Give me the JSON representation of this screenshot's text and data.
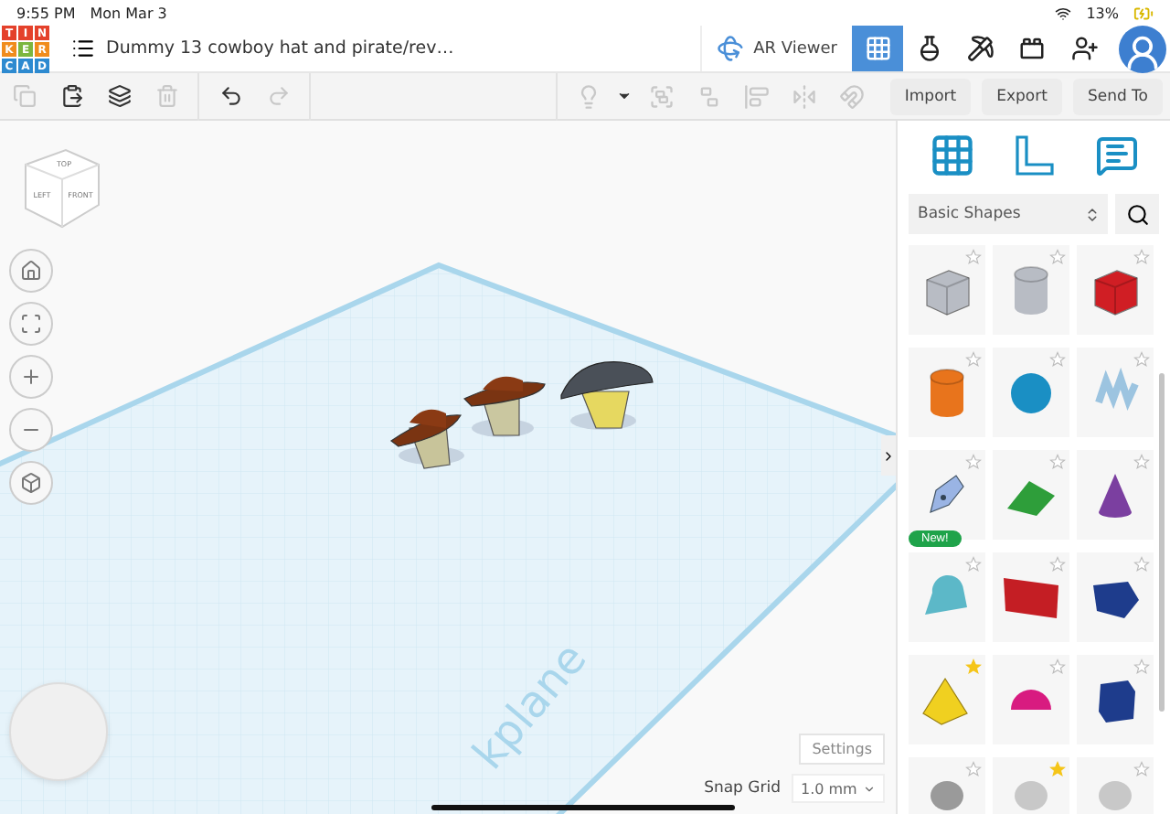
{
  "status_bar": {
    "time": "9:55 PM",
    "date": "Mon Mar 3",
    "battery": "13%"
  },
  "header": {
    "logo_letters": [
      "T",
      "I",
      "N",
      "K",
      "E",
      "R",
      "C",
      "A",
      "D"
    ],
    "title": "Dummy 13 cowboy hat and pirate/rev…",
    "ar_viewer": "AR Viewer",
    "views": [
      {
        "kind": "design",
        "selected": true
      },
      {
        "kind": "sim",
        "selected": false
      },
      {
        "kind": "pickaxe",
        "selected": false
      },
      {
        "kind": "brick",
        "selected": false
      }
    ]
  },
  "toolbar": {
    "left": [
      {
        "kind": "copy",
        "disabled": true
      },
      {
        "kind": "paste",
        "disabled": false
      },
      {
        "kind": "duplicate",
        "disabled": false
      },
      {
        "kind": "delete",
        "disabled": true
      },
      {
        "kind": "undo",
        "disabled": false
      },
      {
        "kind": "redo",
        "disabled": true
      }
    ],
    "right": [
      {
        "kind": "light",
        "disabled": true
      },
      {
        "kind": "caret",
        "disabled": false
      },
      {
        "kind": "group",
        "disabled": true
      },
      {
        "kind": "ungroup",
        "disabled": true
      },
      {
        "kind": "align",
        "disabled": true
      },
      {
        "kind": "mirror",
        "disabled": true
      },
      {
        "kind": "magnet",
        "disabled": true
      }
    ],
    "buttons": [
      "Import",
      "Export",
      "Send To"
    ]
  },
  "canvas": {
    "view_cube": {
      "top": "TOP",
      "left": "LEFT",
      "front": "FRONT"
    },
    "nav": [
      {
        "kind": "home"
      },
      {
        "kind": "fit"
      },
      {
        "kind": "zoom-in"
      },
      {
        "kind": "zoom-out"
      },
      {
        "kind": "ortho"
      }
    ],
    "workplane_label": "kplane",
    "settings": "Settings",
    "snap_grid": {
      "label": "Snap Grid",
      "value": "1.0 mm"
    }
  },
  "sidebar": {
    "panels": [
      {
        "kind": "workplane"
      },
      {
        "kind": "ruler"
      },
      {
        "kind": "notes"
      }
    ],
    "category": "Basic Shapes",
    "shapes": [
      {
        "kind": "striped-box",
        "color": "#b8bcc4",
        "favorite": false
      },
      {
        "kind": "striped-cylinder",
        "color": "#b8bcc4",
        "favorite": false
      },
      {
        "kind": "box",
        "color": "#d01e24",
        "favorite": false
      },
      {
        "kind": "cylinder",
        "color": "#e8741c",
        "favorite": false
      },
      {
        "kind": "sphere",
        "color": "#1a8fc4",
        "favorite": false
      },
      {
        "kind": "scribble",
        "color": "#9cc4e0",
        "favorite": false
      },
      {
        "kind": "pen",
        "color": "#9ab4e4",
        "favorite": false,
        "badge": "New!"
      },
      {
        "kind": "roof",
        "color": "#2e9e3a",
        "favorite": false
      },
      {
        "kind": "cone",
        "color": "#7b3fa0",
        "favorite": false
      },
      {
        "kind": "round-roof",
        "color": "#5cb8c8",
        "favorite": false
      },
      {
        "kind": "text",
        "color": "#c41e24",
        "favorite": false
      },
      {
        "kind": "polygon",
        "color": "#1e3c8c",
        "favorite": false
      },
      {
        "kind": "pyramid",
        "color": "#f0d020",
        "favorite": true
      },
      {
        "kind": "half-sphere",
        "color": "#d81b80",
        "favorite": false
      },
      {
        "kind": "prism",
        "color": "#1e3c8c",
        "favorite": false
      },
      {
        "kind": "partial",
        "color": "#9a9a9a",
        "favorite": false
      },
      {
        "kind": "partial",
        "color": "#c8c8c8",
        "favorite": true
      },
      {
        "kind": "partial",
        "color": "#c8c8c8",
        "favorite": false
      }
    ]
  }
}
